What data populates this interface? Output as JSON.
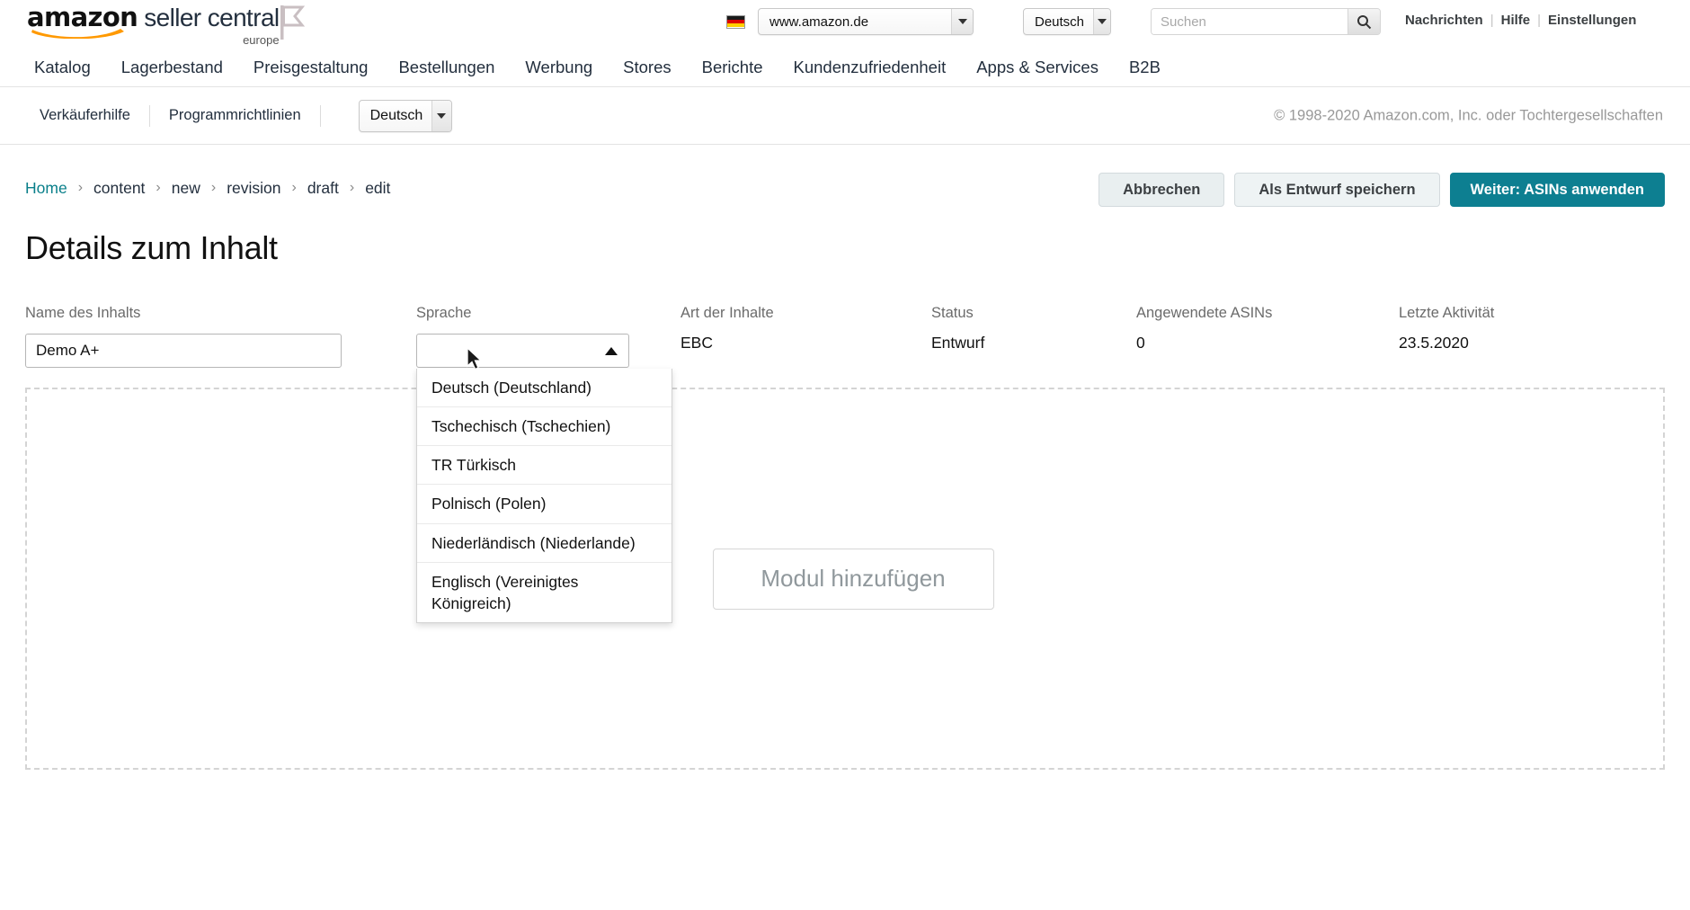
{
  "header": {
    "logo": {
      "brand": "amazon",
      "product": "seller central",
      "region": "europe"
    },
    "marketplace": {
      "label": "www.amazon.de",
      "flag": "de-flag-icon"
    },
    "language": "Deutsch",
    "search": {
      "placeholder": "Suchen",
      "value": ""
    },
    "links": [
      {
        "label": "Nachrichten"
      },
      {
        "label": "Hilfe"
      },
      {
        "label": "Einstellungen"
      }
    ],
    "link_divider": "|"
  },
  "main_nav": {
    "items": [
      {
        "label": "Katalog"
      },
      {
        "label": "Lagerbestand"
      },
      {
        "label": "Preisgestaltung"
      },
      {
        "label": "Bestellungen"
      },
      {
        "label": "Werbung"
      },
      {
        "label": "Stores"
      },
      {
        "label": "Berichte"
      },
      {
        "label": "Kundenzufriedenheit"
      },
      {
        "label": "Apps & Services"
      },
      {
        "label": "B2B"
      }
    ]
  },
  "sub_bar": {
    "links": [
      {
        "label": "Verkäuferhilfe"
      },
      {
        "label": "Programmrichtlinien"
      }
    ],
    "language": "Deutsch",
    "copyright": "© 1998-2020 Amazon.com, Inc. oder Tochtergesellschaften"
  },
  "breadcrumb": {
    "items": [
      {
        "label": "Home"
      },
      {
        "label": "content"
      },
      {
        "label": "new"
      },
      {
        "label": "revision"
      },
      {
        "label": "draft"
      },
      {
        "label": "edit"
      }
    ],
    "separator": "›"
  },
  "actions": {
    "cancel": "Abbrechen",
    "save_draft": "Als Entwurf speichern",
    "next": "Weiter: ASINs anwenden"
  },
  "page": {
    "title": "Details zum Inhalt"
  },
  "fields": {
    "name": {
      "label": "Name des Inhalts",
      "value": "Demo A+"
    },
    "language": {
      "label": "Sprache",
      "value": ""
    },
    "content_type": {
      "label": "Art der Inhalte",
      "value": "EBC"
    },
    "status": {
      "label": "Status",
      "value": "Entwurf"
    },
    "applied_asins": {
      "label": "Angewendete ASINs",
      "value": "0"
    },
    "last_activity": {
      "label": "Letzte Aktivität",
      "value": "23.5.2020"
    }
  },
  "language_dropdown": {
    "open": true,
    "options": [
      {
        "label": "Deutsch (Deutschland)"
      },
      {
        "label": "Tschechisch (Tschechien)"
      },
      {
        "label": "TR Türkisch"
      },
      {
        "label": "Polnisch (Polen)"
      },
      {
        "label": "Niederländisch (Niederlande)"
      },
      {
        "label": "Englisch (Vereinigtes Königreich)"
      }
    ]
  },
  "module_area": {
    "add_module": "Modul hinzufügen"
  },
  "colors": {
    "accent_teal": "#0d7f91",
    "link_teal": "#097f8a",
    "nav_text": "#232f3e",
    "muted": "#6b6b6b"
  }
}
